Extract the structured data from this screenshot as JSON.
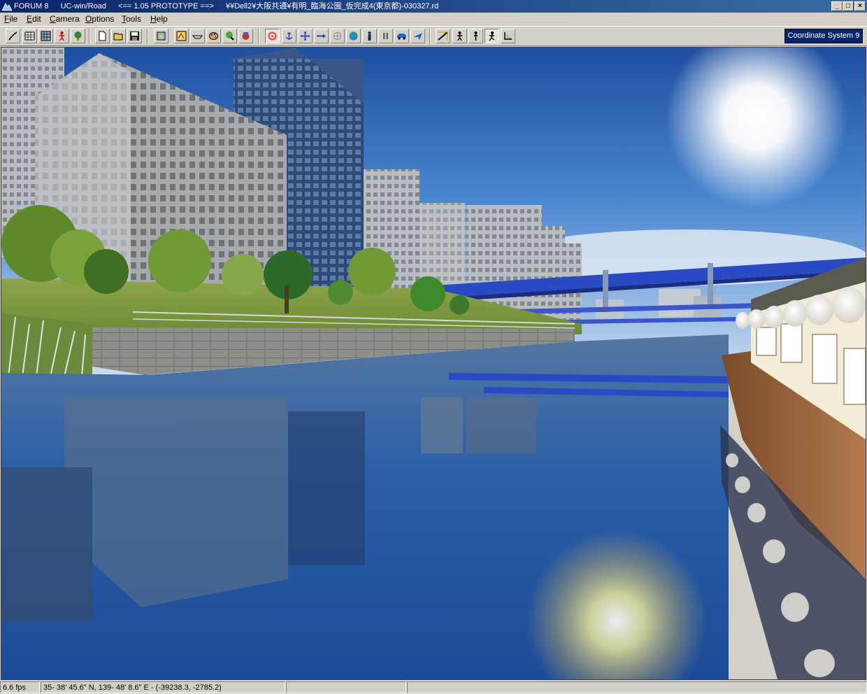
{
  "window": {
    "title_parts": [
      "FORUM 8",
      "UC-win/Road",
      "<== 1.05 PROTOTYPE ==>",
      "¥¥Dell2¥大阪共通¥有明_臨海公園_仮完成4(東京都)-030327.rd"
    ],
    "buttons": {
      "minimize": "_",
      "maximize": "□",
      "close": "×"
    }
  },
  "menu": [
    {
      "label": "File",
      "underline": "F",
      "rest": "ile"
    },
    {
      "label": "Edit",
      "underline": "E",
      "rest": "dit"
    },
    {
      "label": "Camera",
      "underline": "C",
      "rest": "amera"
    },
    {
      "label": "Options",
      "underline": "O",
      "rest": "ptions"
    },
    {
      "label": "Tools",
      "underline": "T",
      "rest": "ools"
    },
    {
      "label": "Help",
      "underline": "H",
      "rest": "elp"
    }
  ],
  "toolbar": {
    "coordinate_system_label": "Coordinate System 9",
    "tools": [
      "road-edit-icon",
      "grid-icon",
      "terrain-grid-icon",
      "person-icon",
      "tree-icon",
      "new-file-icon",
      "open-file-icon",
      "save-icon",
      "export-icon",
      "texture-icon",
      "cross-section-icon",
      "palette-icon",
      "vegetation-icon",
      "model-icon",
      "rotate-icon",
      "anchor-icon",
      "move-icon",
      "arrow-move-icon",
      "navigate-icon",
      "globe-icon",
      "figure-icon",
      "pause-icon",
      "car-icon",
      "plane-icon",
      "view-icon",
      "walk-person-icon",
      "stand-person-icon",
      "run-person-icon",
      "reset-view-icon"
    ]
  },
  "status": {
    "fps": "6.6 fps",
    "position": "35- 38' 45.6\" N, 139- 48' 8.6\" E  -  (-39238.3, -2785.2)"
  },
  "colors": {
    "title_start": "#0a246a",
    "title_end": "#3a6ea5",
    "chrome": "#d4d0c8",
    "coord_button": "#0a246a"
  }
}
